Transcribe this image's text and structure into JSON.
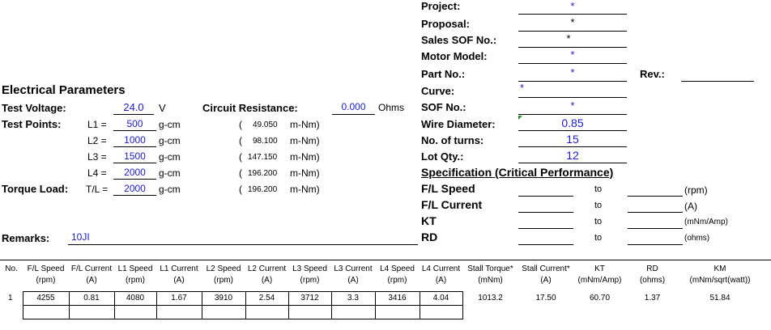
{
  "header_fields": {
    "project": {
      "label": "Project:",
      "value": "*"
    },
    "proposal": {
      "label": "Proposal:",
      "value": "*"
    },
    "sales_sof": {
      "label": "Sales SOF No.:",
      "value": "*"
    },
    "motor_model": {
      "label": "Motor Model:",
      "value": "*"
    },
    "part_no": {
      "label": "Part No.:",
      "value": "*"
    },
    "rev": {
      "label": "Rev.:",
      "value": ""
    },
    "curve": {
      "label": "Curve:",
      "value": "*"
    },
    "sof_no": {
      "label": "SOF No.:",
      "value": "*"
    },
    "wire_diameter": {
      "label": "Wire Diameter:",
      "value": "0.85"
    },
    "turns": {
      "label": "No. of turns:",
      "value": "15"
    },
    "lot_qty": {
      "label": "Lot Qty.:",
      "value": "12"
    }
  },
  "electrical": {
    "title": "Electrical Parameters",
    "test_voltage_label": "Test Voltage:",
    "test_voltage_value": "24.0",
    "test_voltage_unit": "V",
    "circuit_resistance_label": "Circuit Resistance:",
    "circuit_resistance_value": "0.000",
    "circuit_resistance_unit": "Ohms",
    "test_points_label": "Test Points:",
    "torque_load_label": "Torque Load:",
    "points": [
      {
        "name": "L1 =",
        "value": "500",
        "unit": "g-cm",
        "paren": "(",
        "nm": "49.050",
        "nm_unit": "m-Nm)"
      },
      {
        "name": "L2 =",
        "value": "1000",
        "unit": "g-cm",
        "paren": "(",
        "nm": "98.100",
        "nm_unit": "m-Nm)"
      },
      {
        "name": "L3 =",
        "value": "1500",
        "unit": "g-cm",
        "paren": "(",
        "nm": "147.150",
        "nm_unit": "m-Nm)"
      },
      {
        "name": "L4 =",
        "value": "2000",
        "unit": "g-cm",
        "paren": "(",
        "nm": "196.200",
        "nm_unit": "m-Nm)"
      },
      {
        "name": "T/L =",
        "value": "2000",
        "unit": "g-cm",
        "paren": "(",
        "nm": "196.200",
        "nm_unit": "m-Nm)"
      }
    ],
    "remarks_label": "Remarks:",
    "remarks_value": "10JI"
  },
  "specification": {
    "title": "Specification (Critical Performance)",
    "rows": [
      {
        "label": "F/L Speed",
        "to": "to",
        "unit": "(rpm)"
      },
      {
        "label": "F/L Current",
        "to": "to",
        "unit": "(A)"
      },
      {
        "label": "KT",
        "to": "to",
        "unit": "(mNm/Amp)"
      },
      {
        "label": "RD",
        "to": "to",
        "unit": "(ohms)"
      }
    ]
  },
  "table": {
    "headers": [
      {
        "top": "No.",
        "bottom": ""
      },
      {
        "top": "F/L Speed",
        "bottom": "(rpm)"
      },
      {
        "top": "F/L Current",
        "bottom": "(A)"
      },
      {
        "top": "L1 Speed",
        "bottom": "(rpm)"
      },
      {
        "top": "L1 Current",
        "bottom": "(A)"
      },
      {
        "top": "L2 Speed",
        "bottom": "(rpm)"
      },
      {
        "top": "L2 Current",
        "bottom": "(A)"
      },
      {
        "top": "L3 Speed",
        "bottom": "(rpm)"
      },
      {
        "top": "L3 Current",
        "bottom": "(A)"
      },
      {
        "top": "L4 Speed",
        "bottom": "(rpm)"
      },
      {
        "top": "L4 Current",
        "bottom": "(A)"
      },
      {
        "top": "Stall Torque*",
        "bottom": "(mNm)"
      },
      {
        "top": "Stall Current*",
        "bottom": "(A)"
      },
      {
        "top": "KT",
        "bottom": "(mNm/Amp)"
      },
      {
        "top": "RD",
        "bottom": "(ohms)"
      },
      {
        "top": "KM",
        "bottom": "(mNm/sqrt(watt))"
      }
    ],
    "rows": [
      [
        "1",
        "4255",
        "0.81",
        "4080",
        "1.67",
        "3910",
        "2.54",
        "3712",
        "3.3",
        "3416",
        "4.04",
        "1013.2",
        "17.50",
        "60.70",
        "1.37",
        "51.84"
      ]
    ]
  }
}
